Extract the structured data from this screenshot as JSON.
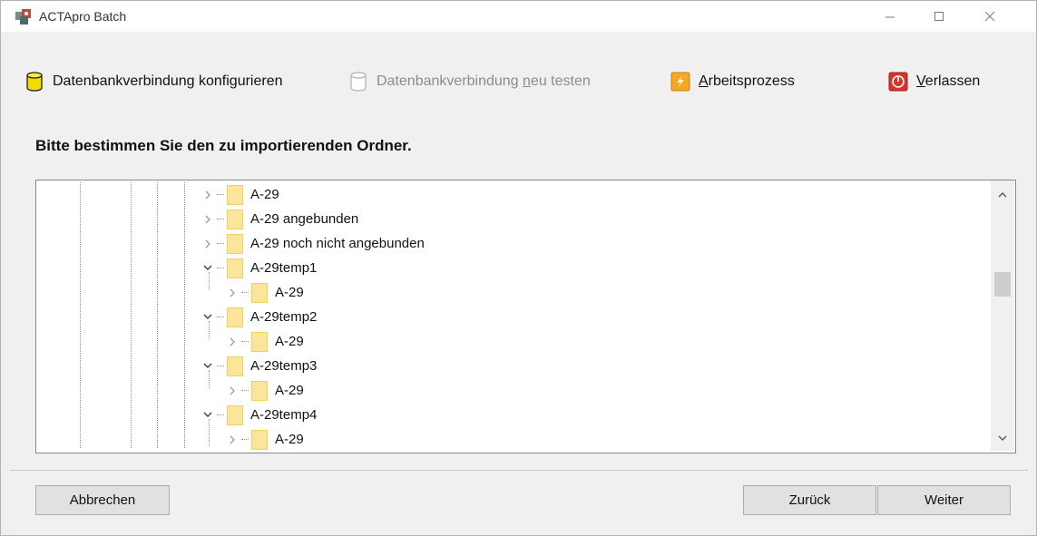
{
  "window": {
    "title": "ACTApro Batch"
  },
  "toolbar": {
    "configure": {
      "label": "Datenbankverbindung konfigurieren"
    },
    "retest": {
      "pre": "Datenbankverbindung ",
      "accel": "n",
      "post": "eu testen"
    },
    "process": {
      "accel": "A",
      "post": "rbeitsprozess"
    },
    "leave": {
      "accel": "V",
      "post": "erlassen"
    }
  },
  "prompt": "Bitte bestimmen Sie den zu importierenden Ordner.",
  "tree": {
    "rows": [
      {
        "label": "A-29",
        "expanded": false,
        "depth": 0
      },
      {
        "label": "A-29 angebunden",
        "expanded": false,
        "depth": 0
      },
      {
        "label": "A-29 noch nicht angebunden",
        "expanded": false,
        "depth": 0
      },
      {
        "label": "A-29temp1",
        "expanded": true,
        "depth": 0
      },
      {
        "label": "A-29",
        "expanded": false,
        "depth": 1
      },
      {
        "label": "A-29temp2",
        "expanded": true,
        "depth": 0
      },
      {
        "label": "A-29",
        "expanded": false,
        "depth": 1
      },
      {
        "label": "A-29temp3",
        "expanded": true,
        "depth": 0
      },
      {
        "label": "A-29",
        "expanded": false,
        "depth": 1
      },
      {
        "label": "A-29temp4",
        "expanded": true,
        "depth": 0
      },
      {
        "label": "A-29",
        "expanded": false,
        "depth": 1
      }
    ]
  },
  "buttons": {
    "cancel": "Abbrechen",
    "back": "Zurück",
    "next": "Weiter"
  },
  "icons": {
    "app": "app-icon",
    "configure": "database-yellow-icon",
    "retest": "database-outline-icon",
    "process": "lightning-icon",
    "leave": "power-icon"
  },
  "colors": {
    "folder": "#fbe59a",
    "db_yellow": "#f2dd00",
    "process_orange": "#f5a623",
    "leave_red": "#d9342b"
  }
}
